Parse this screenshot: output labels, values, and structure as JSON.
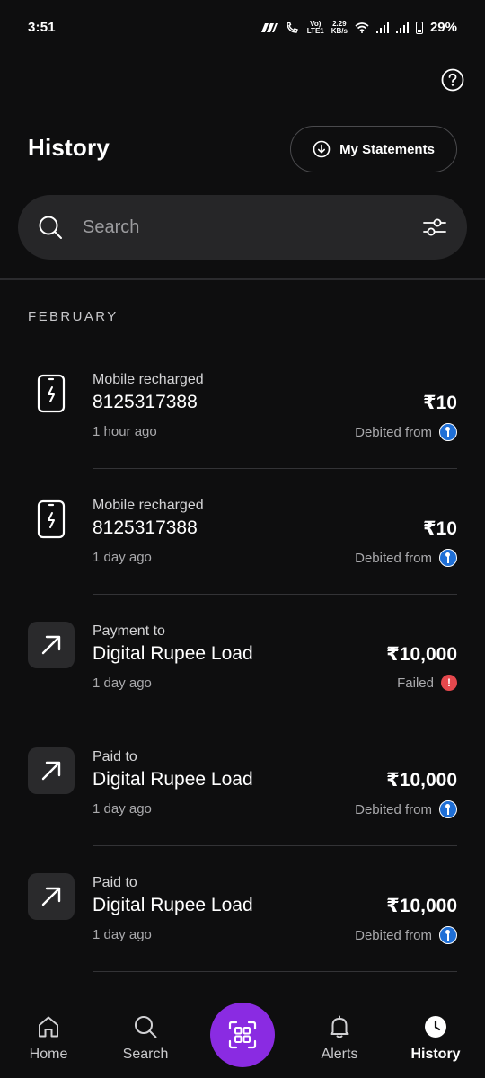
{
  "status_bar": {
    "time": "3:51",
    "network_speed_top": "2.29",
    "network_speed_bottom": "KB/s",
    "volte": "Vo)",
    "lte": "LTE1",
    "battery": "29%"
  },
  "header": {
    "title": "History",
    "statements_label": "My Statements"
  },
  "search": {
    "placeholder": "Search"
  },
  "section": {
    "month": "FEBRUARY"
  },
  "transactions": [
    {
      "type": "Mobile recharged",
      "name": "8125317388",
      "time": "1 hour ago",
      "amount": "₹10",
      "status": "Debited from",
      "icon": "mobile-icon",
      "status_icon": "bank-icon"
    },
    {
      "type": "Mobile recharged",
      "name": "8125317388",
      "time": "1 day ago",
      "amount": "₹10",
      "status": "Debited from",
      "icon": "mobile-icon",
      "status_icon": "bank-icon"
    },
    {
      "type": "Payment to",
      "name": "Digital Rupee Load",
      "time": "1 day ago",
      "amount": "₹10,000",
      "status": "Failed",
      "icon": "arrow-up-right-icon",
      "status_icon": "failed-icon"
    },
    {
      "type": "Paid to",
      "name": "Digital Rupee Load",
      "time": "1 day ago",
      "amount": "₹10,000",
      "status": "Debited from",
      "icon": "arrow-up-right-icon",
      "status_icon": "bank-icon"
    },
    {
      "type": "Paid to",
      "name": "Digital Rupee Load",
      "time": "1 day ago",
      "amount": "₹10,000",
      "status": "Debited from",
      "icon": "arrow-up-right-icon",
      "status_icon": "bank-icon"
    }
  ],
  "failed_glyph": "!",
  "bottom_nav": {
    "home": "Home",
    "search": "Search",
    "alerts": "Alerts",
    "history": "History",
    "active": "history"
  },
  "colors": {
    "background": "#0e0e0f",
    "accent": "#8a2be2",
    "failed": "#e5484d",
    "bank": "#1f6fd6"
  }
}
